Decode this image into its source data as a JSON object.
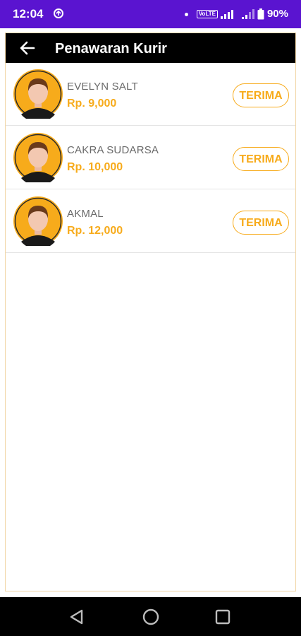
{
  "status_bar": {
    "time": "12:04",
    "network_badge": "VoLTE",
    "battery": "90%",
    "background_color": "#5a14d0"
  },
  "toolbar": {
    "title": "Penawaran Kurir",
    "back_icon": "arrow-left-icon"
  },
  "couriers": [
    {
      "name": "EVELYN SALT",
      "price": "Rp. 9,000",
      "accept_label": "TERIMA",
      "avatar_icon": "courier-avatar-icon"
    },
    {
      "name": "CAKRA SUDARSA",
      "price": "Rp. 10,000",
      "accept_label": "TERIMA",
      "avatar_icon": "courier-avatar-icon"
    },
    {
      "name": "AKMAL",
      "price": "Rp. 12,000",
      "accept_label": "TERIMA",
      "avatar_icon": "courier-avatar-icon"
    }
  ],
  "nav_bar": {
    "back_icon": "triangle-back-icon",
    "home_icon": "circle-home-icon",
    "recents_icon": "square-recents-icon"
  },
  "colors": {
    "accent": "#f7ab1b",
    "toolbar": "#000000",
    "name_text": "#6a6a6a"
  }
}
